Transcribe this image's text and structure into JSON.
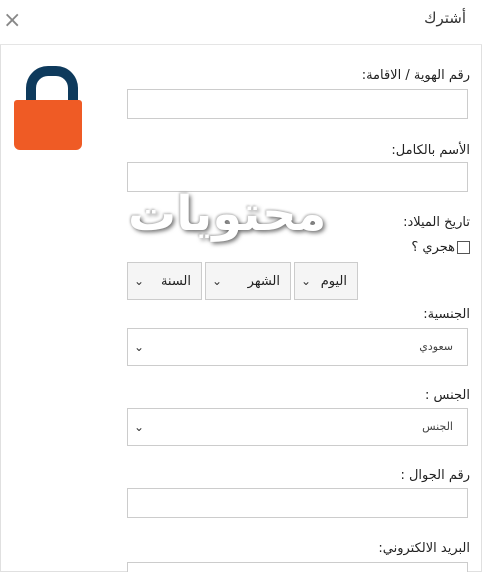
{
  "dialog": {
    "title": "أشترك",
    "close_symbol": "×"
  },
  "form": {
    "id_label": "رقم الهوية / الاقامة:",
    "fullname_label": "الأسم بالكامل:",
    "birthdate_label": "تاريخ الميلاد:",
    "hijri_label": "هجري ؟",
    "day_label": "اليوم",
    "month_label": "الشهر",
    "year_label": "السنة",
    "nationality_label": "الجنسية:",
    "nationality_value": "سعودي",
    "gender_label": "الجنس :",
    "gender_value": "الجنس",
    "mobile_label": "رقم الجوال :",
    "email_label": "البريد الالكتروني:"
  },
  "watermark": "محتويات",
  "icons": {
    "lock": "lock-icon",
    "chevron": "chevron-down-icon"
  },
  "colors": {
    "lock_body": "#ef5b25",
    "lock_shackle": "#0e3a5c"
  }
}
